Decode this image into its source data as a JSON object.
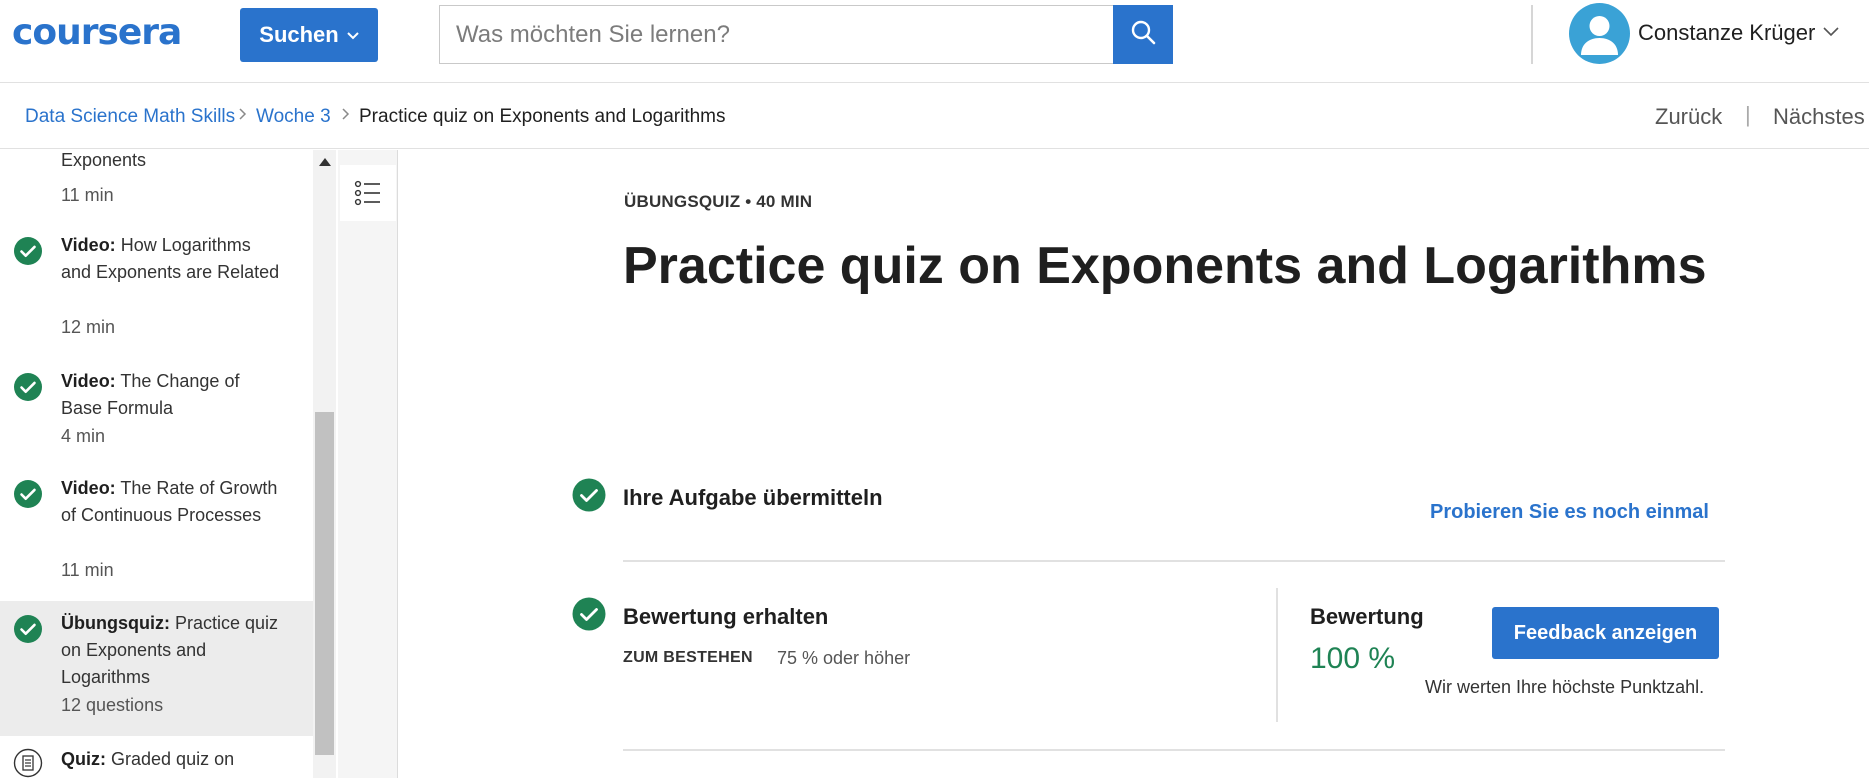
{
  "header": {
    "logo_text": "coursera",
    "search_button_label": "Suchen",
    "search_placeholder": "Was möchten Sie lernen?",
    "user_name": "Constanze Krüger"
  },
  "breadcrumb": {
    "items": [
      "Data Science Math Skills",
      "Woche 3",
      "Practice quiz on Exponents and Logarithms"
    ],
    "prev_label": "Zurück",
    "separator": "|",
    "next_label": "Nächstes"
  },
  "sidebar": {
    "items": [
      {
        "type": "",
        "title": "Exponents",
        "duration": "11 min",
        "status": "done"
      },
      {
        "type": "Video:",
        "title": "How Logarithms and Exponents are Related",
        "duration": "12 min",
        "status": "done"
      },
      {
        "type": "Video:",
        "title": "The Change of Base Formula",
        "duration": "4 min",
        "status": "done"
      },
      {
        "type": "Video:",
        "title": "The Rate of Growth of Continuous Processes",
        "duration": "11 min",
        "status": "done"
      },
      {
        "type": "Übungsquiz:",
        "title": "Practice quiz on Exponents and Logarithms",
        "duration": "12 questions",
        "status": "done"
      },
      {
        "type": "Quiz:",
        "title": "Graded quiz on",
        "duration": "",
        "status": "todo"
      }
    ]
  },
  "main": {
    "kicker": "ÜBUNGSQUIZ • 40 MIN",
    "title": "Practice quiz on Exponents and Logarithms",
    "step1": {
      "title": "Ihre Aufgabe übermitteln",
      "action": "Probieren Sie es noch einmal"
    },
    "step2": {
      "title": "Bewertung erhalten",
      "pass_label": "ZUM BESTEHEN",
      "pass_value": "75 % oder höher",
      "grade_label": "Bewertung",
      "grade_value": "100 %",
      "feedback_button": "Feedback anzeigen",
      "note": "Wir werten Ihre höchste Punktzahl."
    }
  },
  "colors": {
    "brand": "#2a73cc",
    "success": "#1f8354",
    "active_bg": "#ececec"
  }
}
